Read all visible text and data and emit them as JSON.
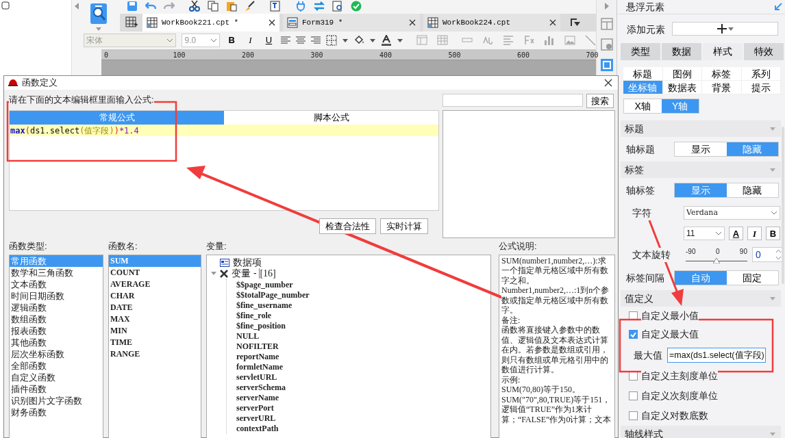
{
  "app": {
    "tabs": [
      {
        "label": "WorkBook221.cpt *",
        "selected": true,
        "kind": "grid"
      },
      {
        "label": "Form319 *",
        "selected": false,
        "kind": "form"
      },
      {
        "label": "WorkBook224.cpt",
        "selected": false,
        "kind": "grid"
      }
    ],
    "font_name": "宋体",
    "font_size": "9.0",
    "format_buttons": [
      {
        "label": "B",
        "kind": "bold"
      },
      {
        "label": "I",
        "kind": "italic"
      },
      {
        "label": "U",
        "kind": "underline"
      }
    ],
    "ruler": [
      "0",
      "100",
      "200",
      "300",
      "400",
      "500",
      "600",
      "700"
    ]
  },
  "dialog": {
    "title": "函数定义",
    "prompt": "请在下面的文本编辑框里面输入公式:",
    "formula_tabs": [
      {
        "label": "常规公式",
        "selected": true
      },
      {
        "label": "脚本公式",
        "selected": false
      }
    ],
    "formula": [
      {
        "text": "max",
        "kind": "function"
      },
      {
        "text": "(",
        "kind": "outer"
      },
      {
        "text": "ds1.select",
        "kind": "text"
      },
      {
        "text": "(",
        "kind": "inner"
      },
      {
        "text": "值字段",
        "kind": "field"
      },
      {
        "text": ")",
        "kind": "inner"
      },
      {
        "text": ")",
        "kind": "outer"
      },
      {
        "text": "*1.4",
        "kind": "number"
      }
    ],
    "search_button": "搜索",
    "buttons": [
      "检查合法性",
      "实时计算"
    ],
    "category_label": "函数类型:",
    "categories": [
      {
        "label": "常用函数",
        "selected": true
      },
      {
        "label": "数学和三角函数",
        "selected": false
      },
      {
        "label": "文本函数",
        "selected": false
      },
      {
        "label": "时间日期函数",
        "selected": false
      },
      {
        "label": "逻辑函数",
        "selected": false
      },
      {
        "label": "数组函数",
        "selected": false
      },
      {
        "label": "报表函数",
        "selected": false
      },
      {
        "label": "其他函数",
        "selected": false
      },
      {
        "label": "层次坐标函数",
        "selected": false
      },
      {
        "label": "全部函数",
        "selected": false
      },
      {
        "label": "自定义函数",
        "selected": false
      },
      {
        "label": "插件函数",
        "selected": false
      },
      {
        "label": "识别图片文字函数",
        "selected": false
      },
      {
        "label": "财务函数",
        "selected": false
      }
    ],
    "name_label": "函数名:",
    "names": [
      {
        "label": "SUM",
        "selected": true
      },
      {
        "label": "COUNT",
        "selected": false
      },
      {
        "label": "AVERAGE",
        "selected": false
      },
      {
        "label": "CHAR",
        "selected": false
      },
      {
        "label": "DATE",
        "selected": false
      },
      {
        "label": "MAX",
        "selected": false
      },
      {
        "label": "MIN",
        "selected": false
      },
      {
        "label": "TIME",
        "selected": false
      },
      {
        "label": "RANGE",
        "selected": false
      }
    ],
    "variables_label": "变量:",
    "tree": [
      {
        "label": "数据项",
        "kind": "data"
      },
      {
        "label": "变量 - ",
        "count": "[16]",
        "kind": "variables",
        "expanded": true,
        "children": [
          "$$page_number",
          "$$totalPage_number",
          "$fine_username",
          "$fine_role",
          "$fine_position",
          "NULL",
          "NOFILTER",
          "reportName",
          "formletName",
          "servletURL",
          "serverSchema",
          "serverName",
          "serverPort",
          "serverURL",
          "contextPath"
        ]
      }
    ],
    "description_label": "公式说明:",
    "description": [
      "SUM(number1,number2,…):求一个指定单元格区域中所有数字之和。",
      "Number1,number2,…:1到n个参数或指定单元格区域中所有数字。",
      "备注:",
      "函数将直接键入参数中的数值、逻辑值及文本表达式计算在内。若参数是数组或引用，则只有数组或单元格引用中的数值进行计算。",
      "示例:",
      "SUM(70,80)等于150。",
      "SUM(\"70\",80,TRUE)等于151，逻辑值“TRUE”作为1来计算；“FALSE”作为0计算；文本"
    ]
  },
  "panel": {
    "title": "悬浮元素",
    "add_label": "添加元素",
    "main_tabs": [
      {
        "label": "类型",
        "selected": false
      },
      {
        "label": "数据",
        "selected": false
      },
      {
        "label": "样式",
        "selected": true
      },
      {
        "label": "特效",
        "selected": false
      }
    ],
    "sub_tabs": [
      {
        "label": "标题",
        "selected": false
      },
      {
        "label": "图例",
        "selected": false
      },
      {
        "label": "标签",
        "selected": false
      },
      {
        "label": "系列",
        "selected": false
      },
      {
        "label": "坐标轴",
        "selected": true
      },
      {
        "label": "数据表",
        "selected": false
      },
      {
        "label": "背景",
        "selected": false
      },
      {
        "label": "提示",
        "selected": false
      }
    ],
    "axis_tabs": [
      {
        "label": "X轴",
        "selected": false
      },
      {
        "label": "Y轴",
        "selected": true
      }
    ],
    "sections": [
      {
        "title": "标题",
        "rows": [
          {
            "kind": "toggle",
            "label": "轴标题",
            "options": [
              {
                "label": "显示",
                "selected": false
              },
              {
                "label": "隐藏",
                "selected": true
              }
            ]
          }
        ]
      },
      {
        "title": "标签",
        "rows": [
          {
            "kind": "toggle",
            "label": "轴标签",
            "options": [
              {
                "label": "显示",
                "selected": true
              },
              {
                "label": "隐藏",
                "selected": false
              }
            ]
          },
          {
            "kind": "select",
            "label": "字符",
            "value": "Verdana"
          },
          {
            "kind": "fontstyle",
            "size": "11",
            "buttons": [
              "A",
              "I",
              "B"
            ]
          },
          {
            "kind": "slider",
            "label": "文本旋转",
            "ticks": [
              "-90",
              "0",
              "90"
            ],
            "level": 0.5,
            "value": "0"
          },
          {
            "kind": "toggle",
            "label": "标签间隔",
            "options": [
              {
                "label": "自动",
                "selected": true
              },
              {
                "label": "固定",
                "selected": false
              }
            ]
          }
        ]
      },
      {
        "title": "值定义",
        "rows": [
          {
            "kind": "checkbox",
            "label": "自定义最小值",
            "checked": false
          },
          {
            "kind": "checkbox",
            "label": "自定义最大值",
            "checked": true
          },
          {
            "kind": "field",
            "label": "最大值",
            "value": "=max(ds1.select(值字段)"
          },
          {
            "kind": "checkbox",
            "label": "自定义主刻度单位",
            "checked": false
          },
          {
            "kind": "checkbox",
            "label": "自定义次刻度单位",
            "checked": false
          },
          {
            "kind": "checkbox",
            "label": "自定义对数底数",
            "checked": false
          }
        ]
      },
      {
        "title": "轴线样式"
      }
    ]
  }
}
